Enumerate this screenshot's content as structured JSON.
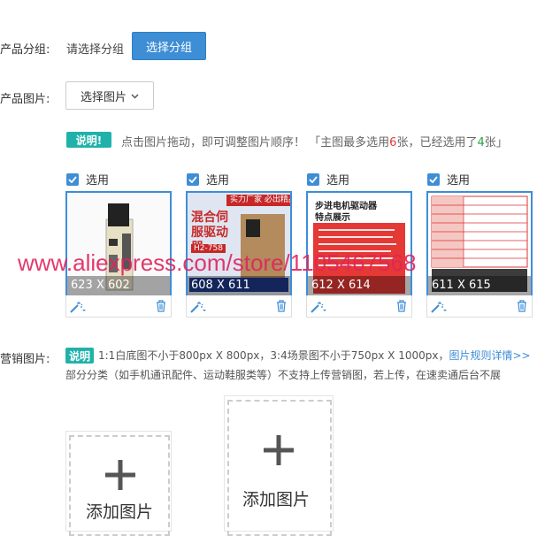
{
  "group": {
    "label": "产品分组:",
    "placeholder": "请选择分组",
    "button": "选择分组"
  },
  "images_section": {
    "label": "产品图片:",
    "dropdown": "选择图片"
  },
  "note": {
    "tag": "说明!",
    "text1": "点击图片拖动，即可调整图片顺序！",
    "text2": "「主图最多选用",
    "max": "6",
    "text3": "张，已经选用了",
    "selected": "4",
    "text4": "张」"
  },
  "thumbnails": [
    {
      "check_label": "选用",
      "size": "623 X 602"
    },
    {
      "check_label": "选用",
      "size": "608 X 611",
      "banner": "实力厂家  必出精品",
      "title": "混合伺服驱动器",
      "model": "H2-758"
    },
    {
      "check_label": "选用",
      "size": "612 X 614",
      "title": "步进电机驱动器",
      "subtitle": "特点展示"
    },
    {
      "check_label": "选用",
      "size": "611 X 615"
    }
  ],
  "marketing": {
    "label": "营销图片:",
    "tag": "说明",
    "text": "1:1白底图不小于800px X 800px，3:4场景图不小于750px X 1000px，",
    "link": "图片规则详情>>",
    "text2": "部分分类（如手机通讯配件、运动鞋服类等）不支持上传营销图，若上传，在速卖通后台不展"
  },
  "add_cards": [
    {
      "label": "添加图片"
    },
    {
      "label": "添加图片"
    }
  ],
  "watermark": "www.aliexpress.com/store/1105467568"
}
